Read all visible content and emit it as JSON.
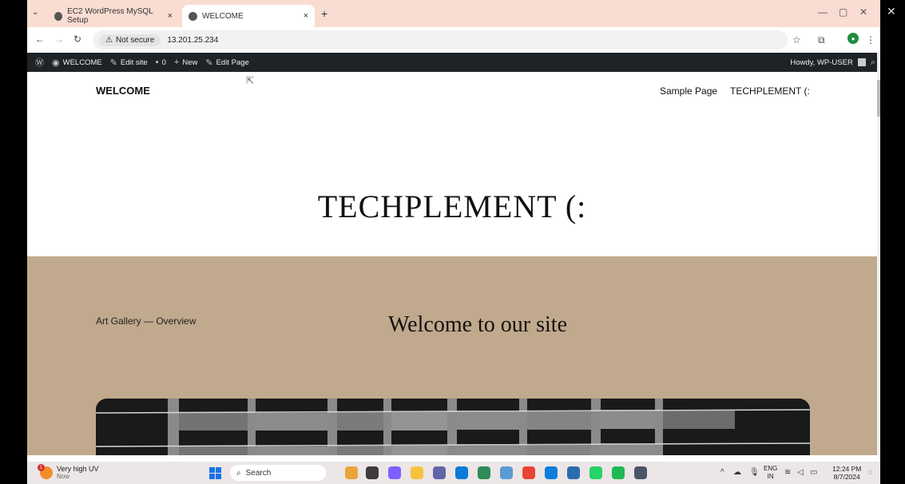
{
  "browser": {
    "tabs": [
      {
        "title": "EC2 WordPress MySQL Setup",
        "active": false
      },
      {
        "title": "WELCOME",
        "active": true
      }
    ],
    "address": {
      "security_label": "Not secure",
      "url": "13.201.25.234"
    }
  },
  "admin_bar": {
    "site": "WELCOME",
    "edit_site": "Edit site",
    "comments_count": "0",
    "new": "New",
    "edit_page": "Edit Page",
    "howdy": "Howdy, WP-USER"
  },
  "site": {
    "title": "WELCOME",
    "nav": [
      "Sample Page",
      "TECHPLEMENT (:"
    ],
    "hero_title": "TECHPLEMENT (:",
    "gallery_label": "Art Gallery — Overview",
    "welcome_heading": "Welcome to our site"
  },
  "taskbar": {
    "weather_title": "Very high UV",
    "weather_sub": "Now",
    "weather_badge": "1",
    "search_label": "Search",
    "lang_top": "ENG",
    "lang_bottom": "IN",
    "time": "12:24 PM",
    "date": "8/7/2024"
  },
  "colors": {
    "tabbar": "#f9dcd2",
    "adminbar": "#1d2327",
    "hero_band": "#c1a98d"
  }
}
